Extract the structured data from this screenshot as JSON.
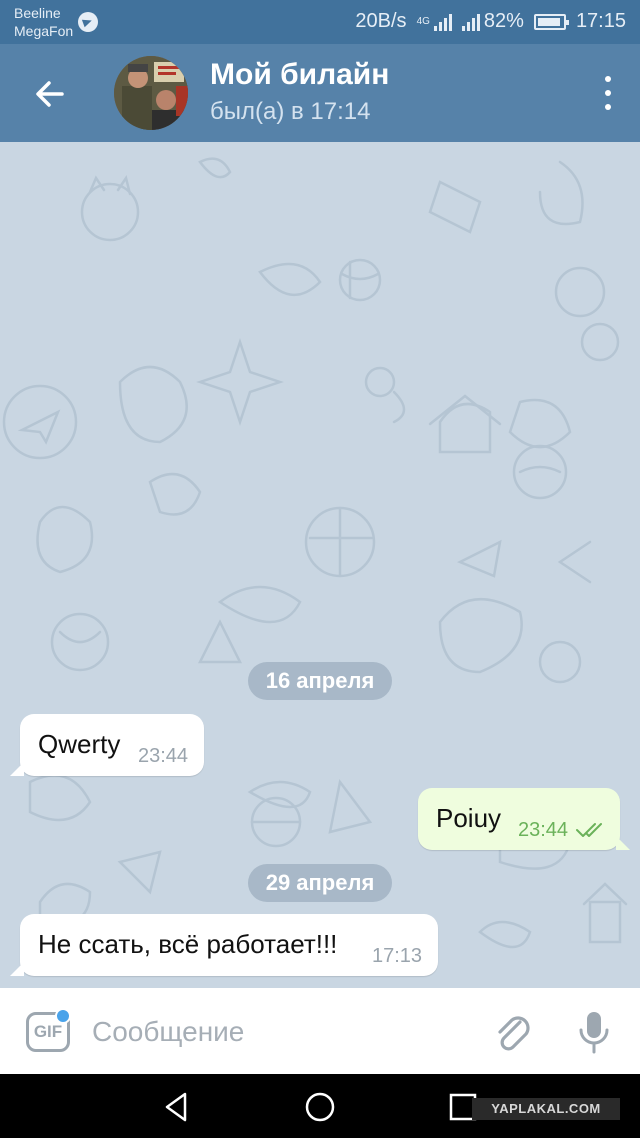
{
  "status_bar": {
    "carrier_1": "Beeline",
    "carrier_2": "MegaFon",
    "speed": "20B/s",
    "network": "4G",
    "battery": "82%",
    "time": "17:15"
  },
  "header": {
    "title": "Мой билайн",
    "subtitle": "был(а) в 17:14",
    "back_icon": "arrow-left-icon",
    "menu_icon": "more-vertical-icon"
  },
  "chat": {
    "background_color": "#c9d6e2",
    "dates": [
      "16 апреля",
      "29 апреля"
    ],
    "messages": [
      {
        "direction": "incoming",
        "text": "Qwerty",
        "time": "23:44"
      },
      {
        "direction": "outgoing",
        "text": "Poiuy",
        "time": "23:44",
        "status": "read"
      },
      {
        "direction": "incoming",
        "text": "Не ссать, всё работает!!!",
        "time": "17:13"
      }
    ]
  },
  "input_bar": {
    "gif_label": "GIF",
    "placeholder": "Сообщение",
    "attach_icon": "paperclip-icon",
    "mic_icon": "microphone-icon"
  },
  "watermark": "YAPLAKAL.COM",
  "colors": {
    "header": "#5682a9",
    "status_bar": "#41729c",
    "outgoing_bubble": "#effdde",
    "incoming_bubble": "#ffffff",
    "accent": "#4aa3ea"
  }
}
